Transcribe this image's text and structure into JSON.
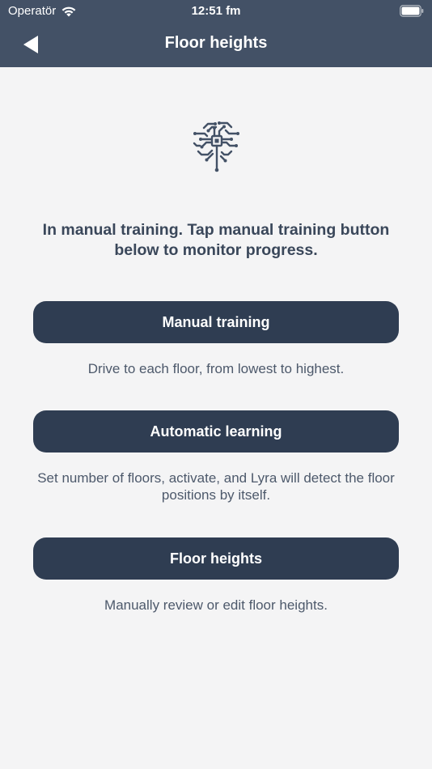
{
  "status_bar": {
    "carrier": "Operatör",
    "time": "12:51 fm"
  },
  "nav": {
    "title": "Floor heights",
    "back_icon": "back-arrow-icon"
  },
  "illustration": {
    "icon": "brain-circuit-icon",
    "color": "#435166"
  },
  "main": {
    "status_message": "In manual training. Tap manual training button below to monitor progress.",
    "options": [
      {
        "label": "Manual training",
        "description": "Drive to each floor, from lowest to highest."
      },
      {
        "label": "Automatic learning",
        "description": "Set number of floors, activate, and Lyra will detect the floor positions by itself."
      },
      {
        "label": "Floor heights",
        "description": "Manually review or edit floor heights."
      }
    ]
  },
  "colors": {
    "header": "#435166",
    "button": "#2f3d52",
    "background": "#f4f4f5"
  }
}
